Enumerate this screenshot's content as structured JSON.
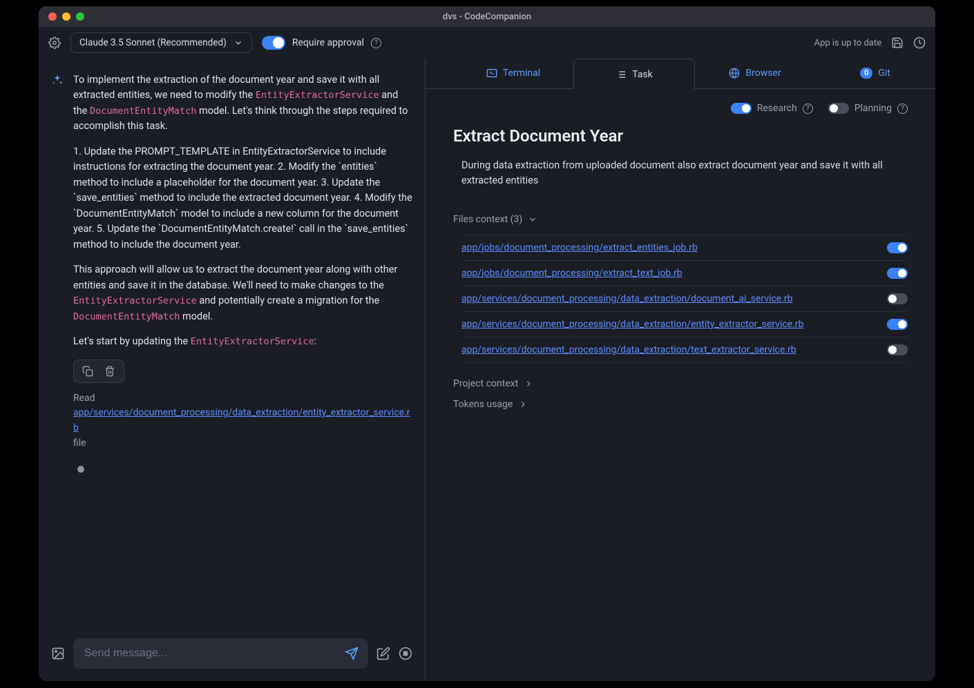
{
  "window_title": "dvs - CodeCompanion",
  "toolbar": {
    "model": "Claude 3.5 Sonnet (Recommended)",
    "require_approval_label": "Require approval",
    "require_approval_on": true,
    "status": "App is up to date"
  },
  "chat": {
    "msg_p1_a": "To implement the extraction of the document year and save it with all extracted entities, we need to modify the ",
    "msg_p1_code1": "EntityExtractorService",
    "msg_p1_b": " and the ",
    "msg_p1_code2": "DocumentEntityMatch",
    "msg_p1_c": " model. Let's think through the steps required to accomplish this task.",
    "msg_p2": "1. Update the PROMPT_TEMPLATE in EntityExtractorService to include instructions for extracting the document year. 2. Modify the `entities` method to include a placeholder for the document year. 3. Update the `save_entities` method to include the extracted document year. 4. Modify the `DocumentEntityMatch` model to include a new column for the document year. 5. Update the `DocumentEntityMatch.create!` call in the `save_entities` method to include the document year.",
    "msg_p3_a": "This approach will allow us to extract the document year along with other entities and save it in the database. We'll need to make changes to the ",
    "msg_p3_code1": "EntityExtractorService",
    "msg_p3_b": " and potentially create a migration for the ",
    "msg_p3_code2": "DocumentEntityMatch",
    "msg_p3_c": " model.",
    "msg_p4_a": "Let's start by updating the ",
    "msg_p4_code1": "EntityExtractorService",
    "msg_p4_b": ":",
    "read_label": "Read",
    "read_path": "app/services/document_processing/data_extraction/entity_extractor_service.rb",
    "read_suffix": "file"
  },
  "composer": {
    "placeholder": "Send message..."
  },
  "tabs": {
    "terminal": "Terminal",
    "task": "Task",
    "browser": "Browser",
    "git": "Git",
    "git_badge": "0"
  },
  "task": {
    "research_label": "Research",
    "research_on": true,
    "planning_label": "Planning",
    "planning_on": false,
    "title": "Extract Document Year",
    "description": "During data extraction from uploaded document also extract document year and save it with all extracted entities",
    "files_header": "Files context (3)",
    "files": [
      {
        "path": "app/jobs/document_processing/extract_entities_job.rb",
        "on": true
      },
      {
        "path": "app/jobs/document_processing/extract_text_job.rb",
        "on": true
      },
      {
        "path": "app/services/document_processing/data_extraction/document_ai_service.rb",
        "on": false
      },
      {
        "path": "app/services/document_processing/data_extraction/entity_extractor_service.rb",
        "on": true
      },
      {
        "path": "app/services/document_processing/data_extraction/text_extractor_service.rb",
        "on": false
      }
    ],
    "project_context_label": "Project context",
    "tokens_label": "Tokens usage"
  }
}
